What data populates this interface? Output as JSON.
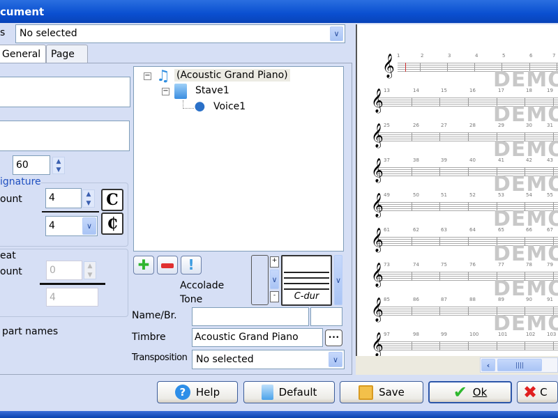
{
  "window": {
    "title": "cument"
  },
  "top": {
    "label": "s",
    "combo_value": "No selected"
  },
  "tabs": [
    {
      "label": "General"
    },
    {
      "label": "Page"
    }
  ],
  "left": {
    "tempo": "60",
    "signature_label": "ignature",
    "count_label": "ount",
    "numerator": "4",
    "denominator": "4",
    "beat_label": "eat",
    "beat_count_label": "ount",
    "beat_num": "0",
    "beat_den": "4",
    "part_names_label": "part names",
    "common_time": "C",
    "cut_time": "₵"
  },
  "tree": {
    "items": [
      {
        "label": "(Acoustic Grand Piano)"
      },
      {
        "label": "Stave1"
      },
      {
        "label": "Voice1"
      }
    ]
  },
  "mid": {
    "accolade_label": "Accolade",
    "tone_label": "Tone",
    "key_label": "C-dur",
    "name_label": "Name/Br.",
    "name_value": "",
    "timbre_label": "Timbre",
    "timbre_value": "Acoustic Grand Piano",
    "browse_label": "•••",
    "transposition_label": "Transposition",
    "transposition_value": "No selected"
  },
  "score": {
    "watermark": "DEMO",
    "rows": [
      [
        1,
        2,
        3,
        4,
        5,
        6,
        7
      ],
      [
        13,
        14,
        15,
        16,
        17,
        18,
        19
      ],
      [
        25,
        26,
        27,
        28,
        29,
        30,
        31
      ],
      [
        37,
        38,
        39,
        40,
        41,
        42,
        43
      ],
      [
        49,
        50,
        51,
        52,
        53,
        54,
        55
      ],
      [
        61,
        62,
        63,
        64,
        65,
        66,
        67
      ],
      [
        73,
        74,
        75,
        76,
        77,
        78,
        79
      ],
      [
        85,
        86,
        87,
        88,
        89,
        90,
        91
      ],
      [
        97,
        98,
        99,
        100,
        101,
        102,
        103
      ]
    ]
  },
  "buttons": {
    "help": "Help",
    "default": "Default",
    "save": "Save",
    "ok": "Ok",
    "cancel": "C"
  }
}
